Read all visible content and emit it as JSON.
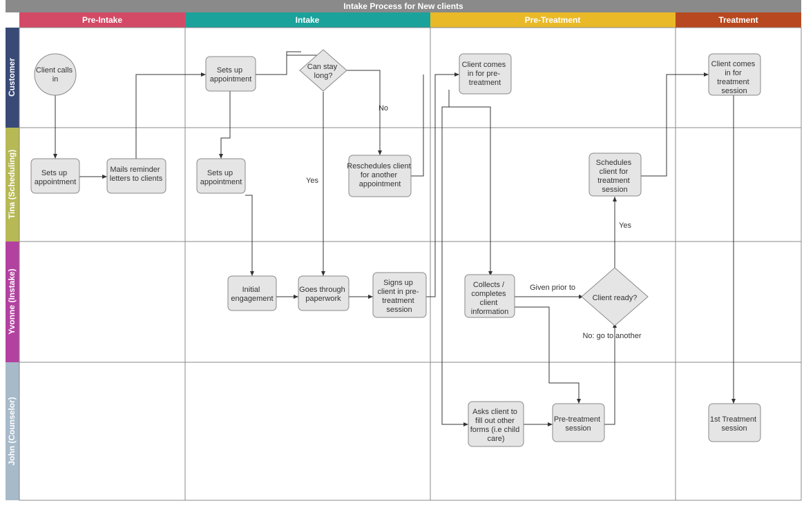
{
  "title": "Intake Process for New clients",
  "phases": [
    {
      "id": "preintake",
      "label": "Pre-Intake",
      "color": "#d34a66"
    },
    {
      "id": "intake",
      "label": "Intake",
      "color": "#1ba29b"
    },
    {
      "id": "pretreat",
      "label": "Pre-Treatment",
      "color": "#e9b928"
    },
    {
      "id": "treat",
      "label": "Treatment",
      "color": "#b8481f"
    }
  ],
  "lanes": [
    {
      "id": "customer",
      "label": "Customer",
      "color": "#394a77"
    },
    {
      "id": "tina",
      "label": "Tina (Scheduling)",
      "color": "#b7b955"
    },
    {
      "id": "yvonne",
      "label": "Yvonne (Instake)",
      "color": "#b341a0"
    },
    {
      "id": "john",
      "label": "John (Counselor)",
      "color": "#a7bac9"
    }
  ],
  "nodes": {
    "client_calls": "Client calls in",
    "setsup1": "Sets up appointment",
    "mails": "Mails reminder letters to clients",
    "setsup_cust": "Sets up appointment",
    "canstay": "Can stay long?",
    "setsup_tina2": "Sets up appointment",
    "reschedule": "Reschedules client for another appointment",
    "initial": "Initial engagement",
    "paperwork": "Goes through paperwork",
    "signsup": "Signs up client in pre-treatment session",
    "comesin_pre": "Client comes in for pre-treatment",
    "collects": "Collects / completes client information",
    "asks": "Asks client to fill out other forms (i.e child care)",
    "pretreat_sess": "Pre-treatment session",
    "clientready": "Client ready?",
    "schedules": "Schedules client for treatment session",
    "comesin_treat": "Client comes in for treatment session",
    "firstsession": "1st Treatment session"
  },
  "edge_labels": {
    "yes1": "Yes",
    "no1": "No",
    "given_prior": "Given prior to",
    "no_goto": "No: go to another",
    "yes2": "Yes"
  }
}
